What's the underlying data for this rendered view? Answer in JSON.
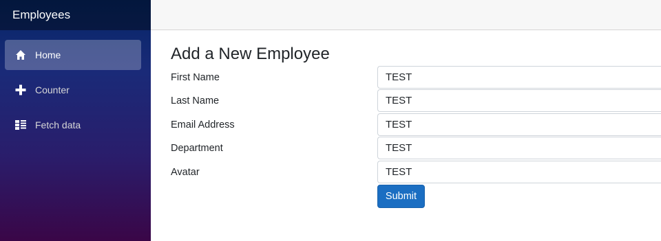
{
  "sidebar": {
    "brand": "Employees",
    "items": [
      {
        "label": "Home",
        "icon": "home-icon",
        "active": true
      },
      {
        "label": "Counter",
        "icon": "plus-icon",
        "active": false
      },
      {
        "label": "Fetch data",
        "icon": "list-icon",
        "active": false
      }
    ]
  },
  "main": {
    "title": "Add a New Employee",
    "fields": [
      {
        "label": "First Name",
        "value": "TEST"
      },
      {
        "label": "Last Name",
        "value": "TEST"
      },
      {
        "label": "Email Address",
        "value": "TEST"
      },
      {
        "label": "Department",
        "value": "TEST"
      },
      {
        "label": "Avatar",
        "value": "TEST"
      }
    ],
    "submit_label": "Submit"
  },
  "colors": {
    "primary": "#1b6ec2",
    "sidebar_top": "#052767",
    "sidebar_bottom": "#3a0647"
  }
}
